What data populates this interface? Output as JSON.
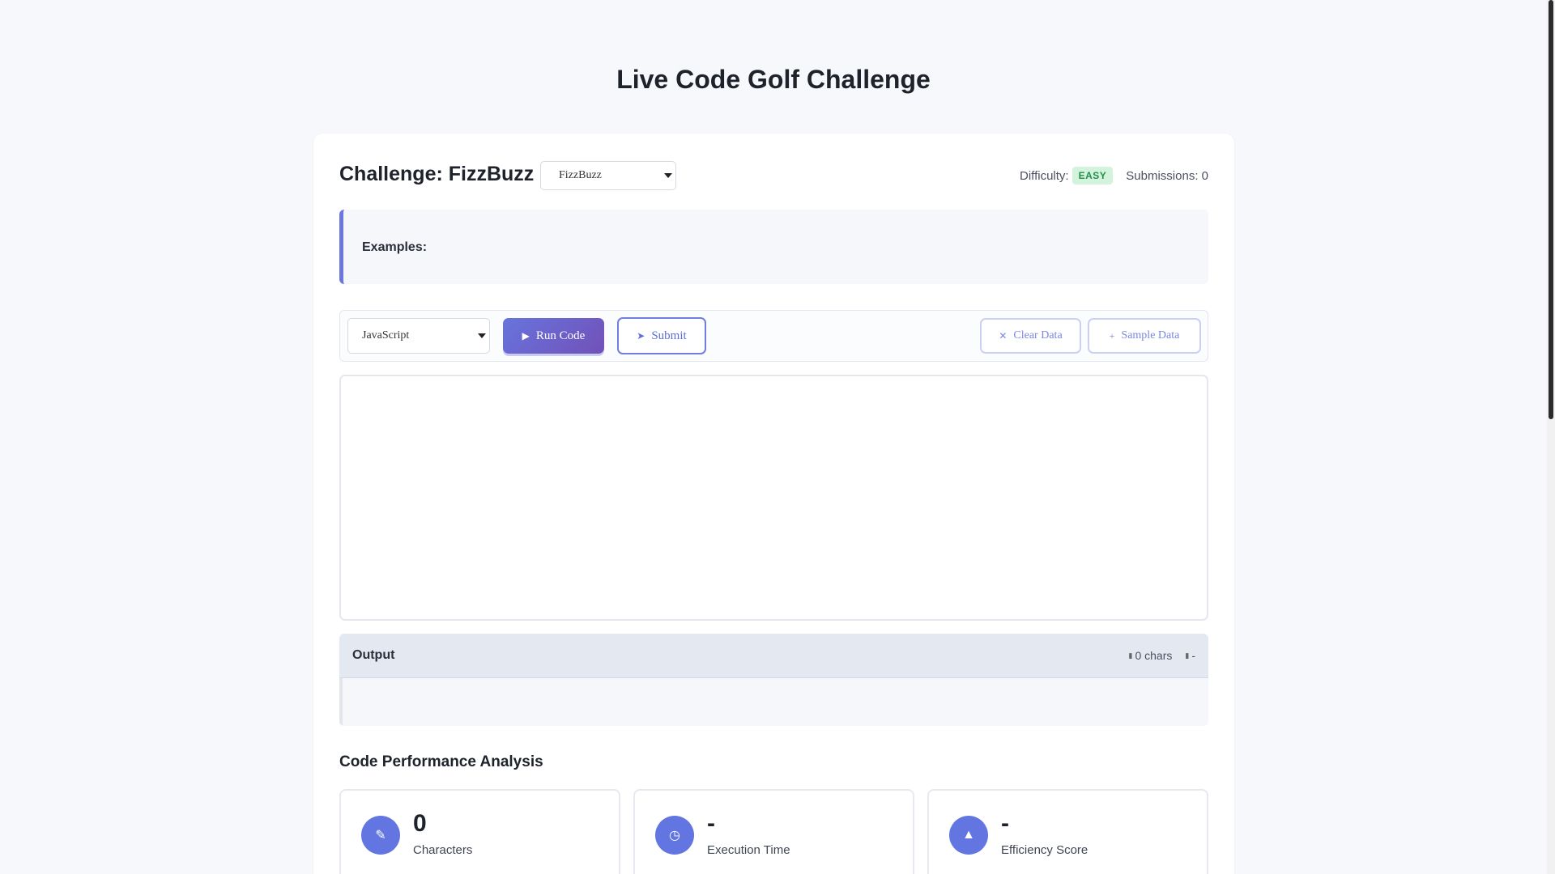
{
  "page": {
    "title": "Live Code Golf Challenge"
  },
  "challenge": {
    "title": "Challenge: FizzBuzz",
    "selected": "FizzBuzz",
    "difficulty_label": "Difficulty:",
    "difficulty": "EASY",
    "submissions": "Submissions: 0"
  },
  "examples": {
    "label": "Examples:"
  },
  "toolbar": {
    "language": "JavaScript",
    "run_label": "Run Code",
    "submit_label": "Submit",
    "clear_label": "Clear Data",
    "sample_label": "Sample Data",
    "sample_icon": "+"
  },
  "output": {
    "label": "Output",
    "chars": "0 chars",
    "time": "-"
  },
  "analysis": {
    "title": "Code Performance Analysis",
    "metrics": [
      {
        "value": "0",
        "label": "Characters",
        "icon": "text-icon"
      },
      {
        "value": "-",
        "label": "Execution Time",
        "icon": "clock-icon"
      },
      {
        "value": "-",
        "label": "Efficiency Score",
        "icon": "chart-icon"
      }
    ]
  },
  "colors": {
    "accent": "#6275e0",
    "badge_bg": "#d4f3dd",
    "badge_text": "#23904a"
  }
}
